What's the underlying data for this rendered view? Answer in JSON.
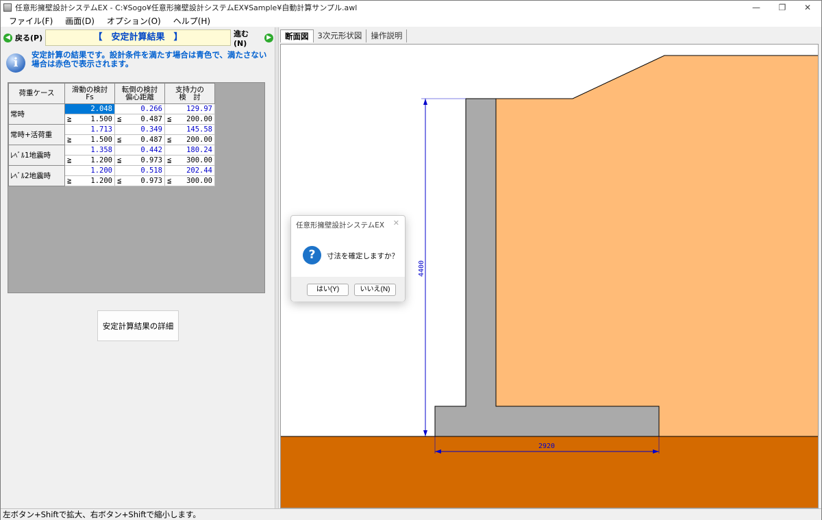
{
  "window": {
    "title": "任意形擁壁設計システムEX - C:¥Sogo¥任意形擁壁設計システムEX¥Sample¥自動計算サンプル.awl",
    "minimize": "—",
    "restore": "❐",
    "close": "✕"
  },
  "menu": [
    "ファイル(F)",
    "画面(D)",
    "オプション(O)",
    "ヘルプ(H)"
  ],
  "nav": {
    "back_label": "戻る(P)",
    "forward_label": "進む(N)",
    "title": "【　安定計算結果　】"
  },
  "info": {
    "text": "安定計算の結果です。設計条件を満たす場合は青色で、満たさない場合は赤色で表示されます。"
  },
  "grid": {
    "headers": [
      "荷重ケース",
      "滑動の検討\nFs",
      "転倒の検討\n偏心距離",
      "支持力の\n検　討"
    ],
    "rows": [
      {
        "case": "常時",
        "fs": "2.048",
        "fs_limit": "1.500",
        "ecc": "0.266",
        "ecc_limit": "0.487",
        "bearing": "129.97",
        "bearing_limit": "200.00"
      },
      {
        "case": "常時+活荷重",
        "fs": "1.713",
        "fs_limit": "1.500",
        "ecc": "0.349",
        "ecc_limit": "0.487",
        "bearing": "145.58",
        "bearing_limit": "200.00"
      },
      {
        "case": "ﾚﾍﾞﾙ1地震時",
        "fs": "1.358",
        "fs_limit": "1.200",
        "ecc": "0.442",
        "ecc_limit": "0.973",
        "bearing": "180.24",
        "bearing_limit": "300.00"
      },
      {
        "case": "ﾚﾍﾞﾙ2地震時",
        "fs": "1.200",
        "fs_limit": "1.200",
        "ecc": "0.518",
        "ecc_limit": "0.973",
        "bearing": "202.44",
        "bearing_limit": "300.00"
      }
    ],
    "ge": "≧",
    "le": "≦"
  },
  "detail_button": "安定計算結果の詳細",
  "tabs": [
    "断面図",
    "3次元形状図",
    "操作説明"
  ],
  "drawing": {
    "height_dim": "4400",
    "width_dim": "2920",
    "colors": {
      "soil_back": "#ffbb77",
      "ground": "#d46a00",
      "concrete": "#aaaaaa",
      "dim": "#0000cc"
    }
  },
  "dialog": {
    "title": "任意形擁壁設計システムEX",
    "close": "✕",
    "icon": "?",
    "message": "寸法を確定しますか？",
    "yes": "はい(Y)",
    "no": "いいえ(N)"
  },
  "status": "左ボタン+Shiftで拡大、右ボタン+Shiftで縮小します。"
}
